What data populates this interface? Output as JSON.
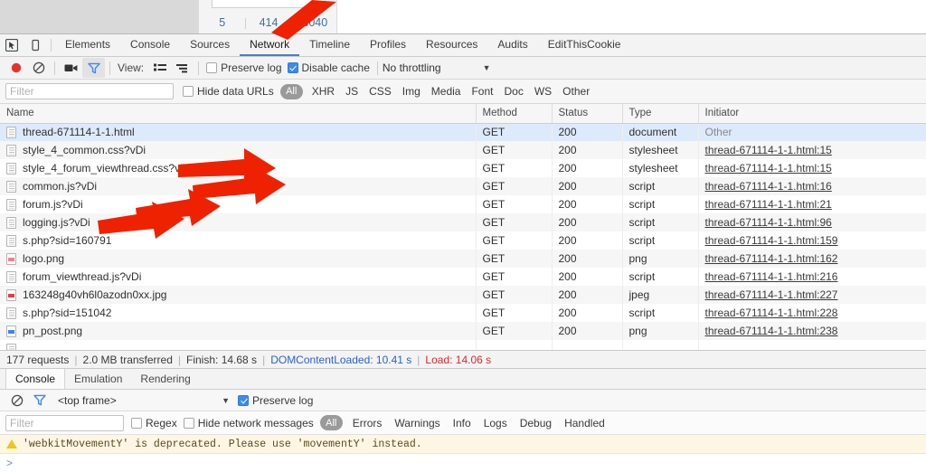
{
  "page_strip": {
    "numbers": [
      "5",
      "414",
      "3040"
    ]
  },
  "devtools": {
    "tabs": [
      {
        "label": "Elements",
        "active": false
      },
      {
        "label": "Console",
        "active": false
      },
      {
        "label": "Sources",
        "active": false
      },
      {
        "label": "Network",
        "active": true
      },
      {
        "label": "Timeline",
        "active": false
      },
      {
        "label": "Profiles",
        "active": false
      },
      {
        "label": "Resources",
        "active": false
      },
      {
        "label": "Audits",
        "active": false
      },
      {
        "label": "EditThisCookie",
        "active": false
      }
    ],
    "toolbar": {
      "view_label": "View:",
      "preserve_log": "Preserve log",
      "preserve_log_checked": false,
      "disable_cache": "Disable cache",
      "disable_cache_checked": true,
      "throttling": "No throttling"
    },
    "filterbar": {
      "filter_placeholder": "Filter",
      "filter_value": "",
      "hide_data_urls": "Hide data URLs",
      "hide_data_urls_checked": false,
      "types": [
        "All",
        "XHR",
        "JS",
        "CSS",
        "Img",
        "Media",
        "Font",
        "Doc",
        "WS",
        "Other"
      ],
      "active_type": "All"
    },
    "table": {
      "columns": [
        "Name",
        "Method",
        "Status",
        "Type",
        "Initiator"
      ],
      "rows": [
        {
          "name": "thread-671114-1-1.html",
          "icon": "doc",
          "method": "GET",
          "status": "200",
          "type": "document",
          "initiator": "Other",
          "initiator_link": false,
          "selected": true
        },
        {
          "name": "style_4_common.css?vDi",
          "icon": "doc",
          "method": "GET",
          "status": "200",
          "type": "stylesheet",
          "initiator": "thread-671114-1-1.html:15",
          "initiator_link": true,
          "selected": false
        },
        {
          "name": "style_4_forum_viewthread.css?vDi",
          "icon": "doc",
          "method": "GET",
          "status": "200",
          "type": "stylesheet",
          "initiator": "thread-671114-1-1.html:15",
          "initiator_link": true,
          "selected": false
        },
        {
          "name": "common.js?vDi",
          "icon": "doc",
          "method": "GET",
          "status": "200",
          "type": "script",
          "initiator": "thread-671114-1-1.html:16",
          "initiator_link": true,
          "selected": false
        },
        {
          "name": "forum.js?vDi",
          "icon": "doc",
          "method": "GET",
          "status": "200",
          "type": "script",
          "initiator": "thread-671114-1-1.html:21",
          "initiator_link": true,
          "selected": false
        },
        {
          "name": "logging.js?vDi",
          "icon": "doc",
          "method": "GET",
          "status": "200",
          "type": "script",
          "initiator": "thread-671114-1-1.html:96",
          "initiator_link": true,
          "selected": false
        },
        {
          "name": "s.php?sid=160791",
          "icon": "doc",
          "method": "GET",
          "status": "200",
          "type": "script",
          "initiator": "thread-671114-1-1.html:159",
          "initiator_link": true,
          "selected": false
        },
        {
          "name": "logo.png",
          "icon": "img-pink",
          "method": "GET",
          "status": "200",
          "type": "png",
          "initiator": "thread-671114-1-1.html:162",
          "initiator_link": true,
          "selected": false
        },
        {
          "name": "forum_viewthread.js?vDi",
          "icon": "doc",
          "method": "GET",
          "status": "200",
          "type": "script",
          "initiator": "thread-671114-1-1.html:216",
          "initiator_link": true,
          "selected": false
        },
        {
          "name": "163248g40vh6l0azodn0xx.jpg",
          "icon": "img-red",
          "method": "GET",
          "status": "200",
          "type": "jpeg",
          "initiator": "thread-671114-1-1.html:227",
          "initiator_link": true,
          "selected": false
        },
        {
          "name": "s.php?sid=151042",
          "icon": "doc",
          "method": "GET",
          "status": "200",
          "type": "script",
          "initiator": "thread-671114-1-1.html:228",
          "initiator_link": true,
          "selected": false
        },
        {
          "name": "pn_post.png",
          "icon": "img-blue",
          "method": "GET",
          "status": "200",
          "type": "png",
          "initiator": "thread-671114-1-1.html:238",
          "initiator_link": true,
          "selected": false
        }
      ]
    },
    "status": {
      "requests": "177 requests",
      "transferred": "2.0 MB transferred",
      "finish": "Finish: 14.68 s",
      "dom_content_loaded": "DOMContentLoaded: 10.41 s",
      "load": "Load: 14.06 s"
    }
  },
  "drawer": {
    "tabs": [
      {
        "label": "Console",
        "active": true
      },
      {
        "label": "Emulation",
        "active": false
      },
      {
        "label": "Rendering",
        "active": false
      }
    ],
    "frame": "<top frame>",
    "preserve_log": "Preserve log",
    "preserve_log_checked": true,
    "filter_placeholder": "Filter",
    "filter_value": "",
    "regex": "Regex",
    "regex_checked": false,
    "hide_network_messages": "Hide network messages",
    "hide_network_messages_checked": false,
    "levels": [
      "All",
      "Errors",
      "Warnings",
      "Info",
      "Logs",
      "Debug",
      "Handled"
    ],
    "active_level": "All",
    "messages": [
      {
        "level": "warning",
        "text": "'webkitMovementY' is deprecated. Please use 'movementY' instead."
      }
    ],
    "prompt": ">"
  },
  "colors": {
    "accent": "#4a7fc1",
    "selected_row": "#ddeafb",
    "dcl": "#2b5fd9",
    "load": "#d92b2b",
    "arrow": "#ee2200"
  }
}
